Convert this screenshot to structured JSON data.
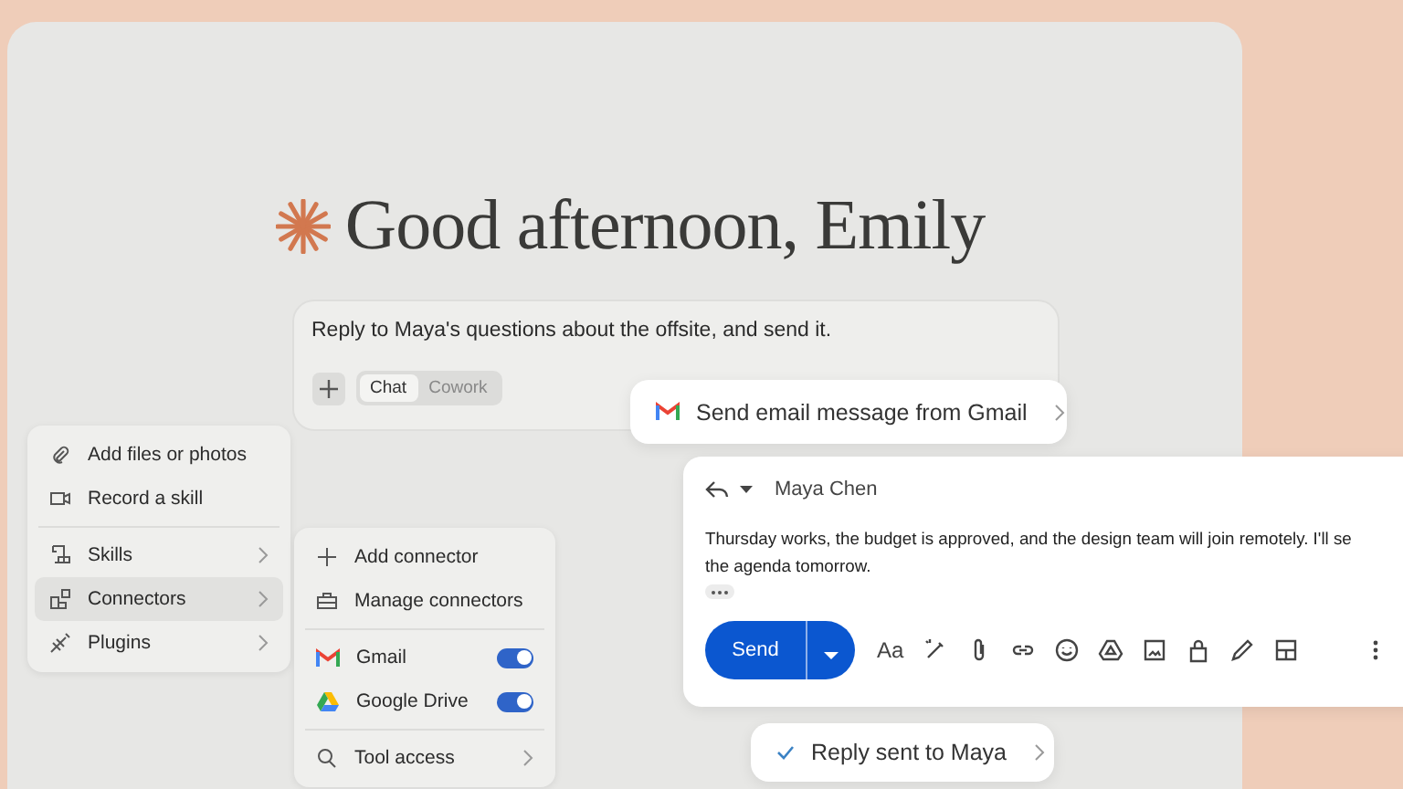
{
  "greeting": "Good afternoon, Emily",
  "prompt": {
    "text": "Reply to Maya's questions about the offsite, and send it.",
    "modes": [
      {
        "label": "Chat",
        "selected": true
      },
      {
        "label": "Cowork",
        "selected": false
      }
    ]
  },
  "menu": {
    "items": [
      {
        "kind": "action",
        "label": "Add files or photos"
      },
      {
        "kind": "action",
        "label": "Record a skill"
      },
      {
        "kind": "submenu",
        "label": "Skills",
        "selected": false
      },
      {
        "kind": "submenu",
        "label": "Connectors",
        "selected": true
      },
      {
        "kind": "submenu",
        "label": "Plugins",
        "selected": false
      }
    ]
  },
  "submenu": {
    "items": [
      {
        "kind": "action",
        "label": "Add connector"
      },
      {
        "kind": "action",
        "label": "Manage connectors"
      },
      {
        "kind": "toggle",
        "label": "Gmail",
        "on": true
      },
      {
        "kind": "toggle",
        "label": "Google Drive",
        "on": true
      },
      {
        "kind": "submenu",
        "label": "Tool access",
        "selected": false
      }
    ]
  },
  "tool_call": {
    "label": "Send email message from Gmail"
  },
  "email": {
    "recipient": "Maya Chen",
    "body_lines": [
      "Thursday works, the budget is approved, and the design team will join remotely. I'll se",
      "the agenda tomorrow."
    ],
    "format_label": "Aa",
    "send_label": "Send"
  },
  "status": {
    "label": "Reply sent to Maya"
  }
}
